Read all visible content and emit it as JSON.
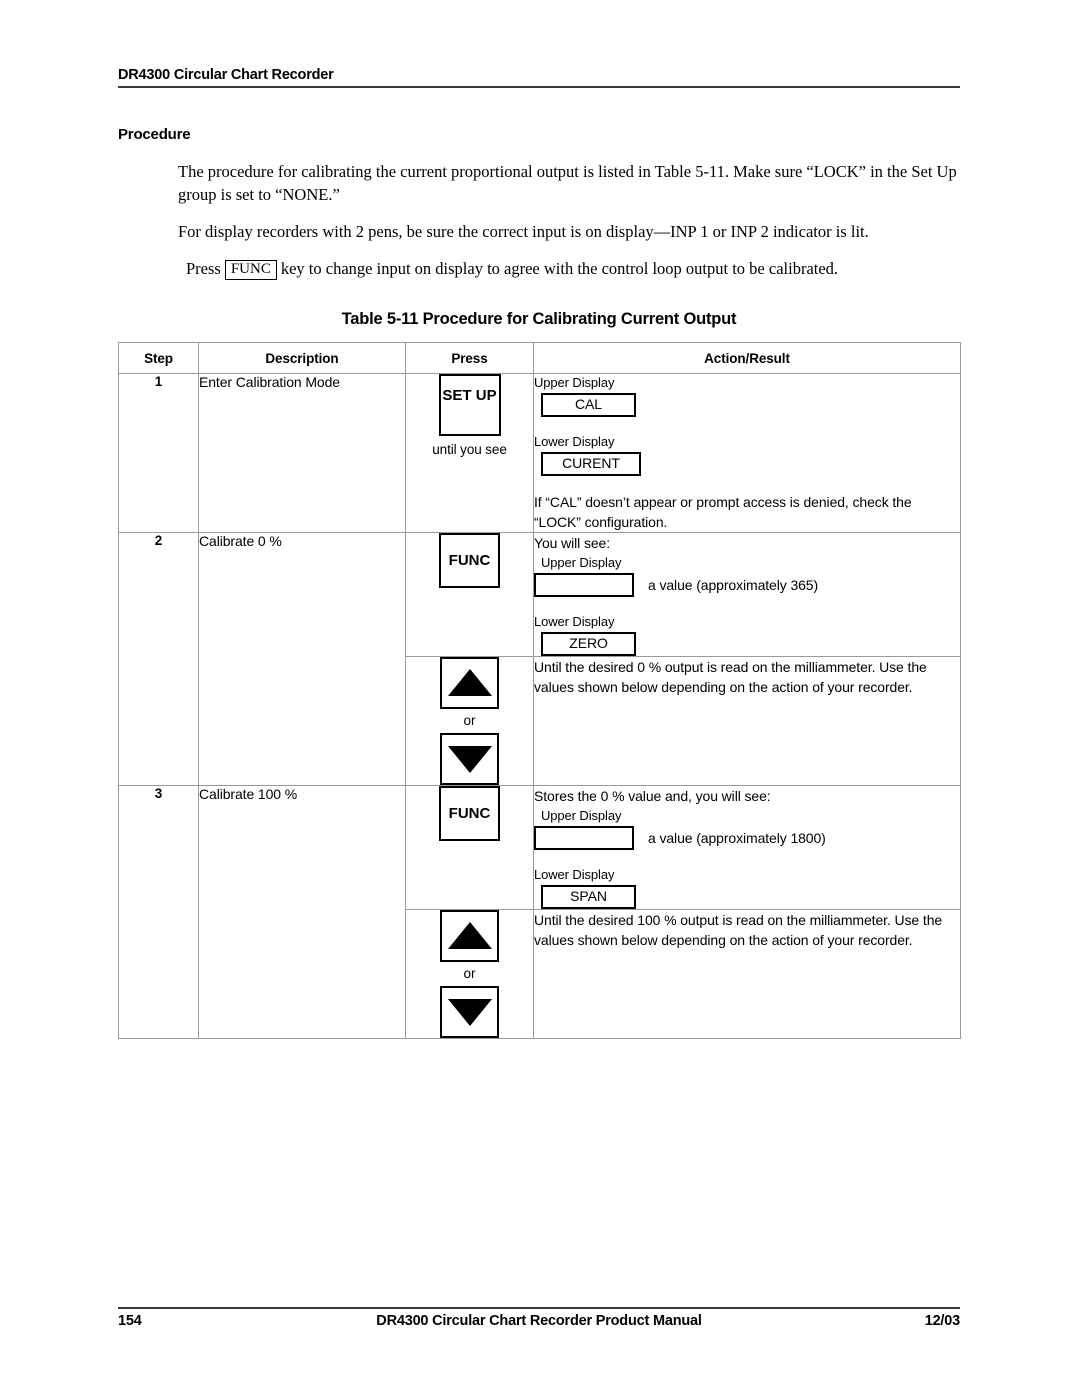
{
  "header": {
    "title": "DR4300 Circular Chart Recorder"
  },
  "section": {
    "heading": "Procedure",
    "para1": "The procedure for calibrating the current proportional output is listed in Table 5-11. Make sure “LOCK” in the Set Up group is set to “NONE.”",
    "para2": "For display recorders with 2 pens, be sure the correct input is on display—INP 1 or INP 2 indicator is lit.",
    "para3_before": "Press",
    "para3_key": "FUNC",
    "para3_after": "key to change input on display to agree with the control loop output to be calibrated."
  },
  "table": {
    "title": "Table 5-11  Procedure for Calibrating Current Output",
    "columns": [
      "Step",
      "Description",
      "Press",
      "Action/Result"
    ],
    "rows": [
      {
        "step": "1",
        "description": "Enter Calibration Mode",
        "press_key": "SET UP",
        "press_sub": "until you see",
        "upper_label": "Upper Display",
        "upper_value": "CAL",
        "lower_label": "Lower Display",
        "lower_value": "CURENT",
        "note": "If “CAL” doesn’t appear or prompt access is denied, check the “LOCK” configuration."
      },
      {
        "step": "2",
        "description": "Calibrate 0 %",
        "press_key": "FUNC",
        "lead": "You will see:",
        "upper_label": "Upper Display",
        "upper_value": "",
        "upper_side": "a value (approximately 365)",
        "lower_label": "Lower Display",
        "lower_value": "ZERO"
      },
      {
        "step": "",
        "description": "",
        "press_key": "arrows",
        "or_label": "or",
        "note": "Until the desired 0 % output is read on the milliammeter. Use the values shown below depending on the action of your recorder."
      },
      {
        "step": "3",
        "description": "Calibrate 100 %",
        "press_key": "FUNC",
        "lead": "Stores the 0 % value and, you will see:",
        "upper_label": "Upper Display",
        "upper_value": "",
        "upper_side": "a value (approximately 1800)",
        "lower_label": "Lower Display",
        "lower_value": "SPAN"
      },
      {
        "step": "",
        "description": "",
        "press_key": "arrows",
        "or_label": "or",
        "note": "Until the desired 100 % output is read on the milliammeter. Use the values shown below depending on the action of your recorder."
      }
    ]
  },
  "footer": {
    "page_number": "154",
    "document_title": "DR4300 Circular Chart Recorder Product Manual",
    "date": "12/03"
  }
}
